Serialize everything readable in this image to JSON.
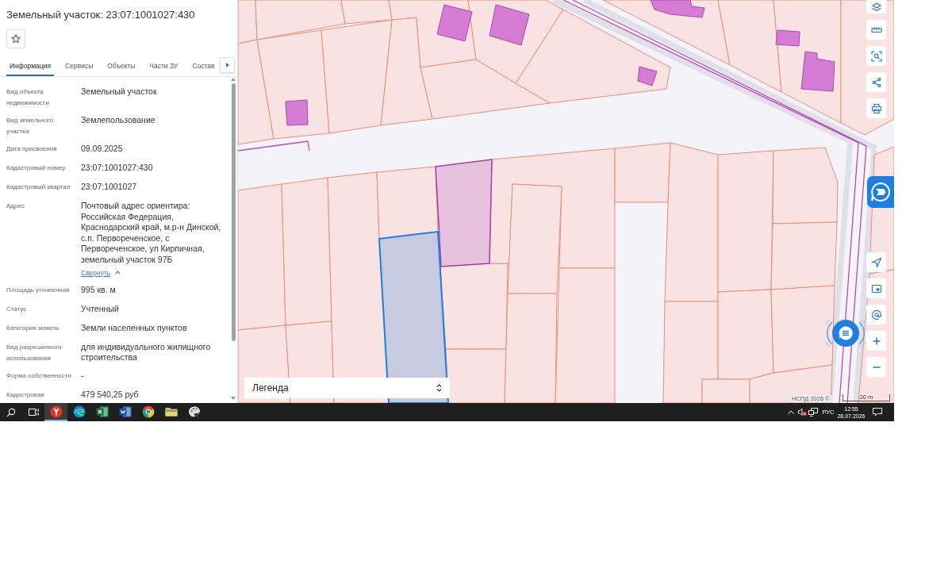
{
  "panel": {
    "title": "Земельный участок: 23:07:1001027:430",
    "tabs": [
      {
        "label": "Информация",
        "selected": true
      },
      {
        "label": "Сервисы",
        "selected": false
      },
      {
        "label": "Объекты",
        "selected": false
      },
      {
        "label": "Части ЗУ",
        "selected": false
      },
      {
        "label": "Состав",
        "selected": false
      }
    ],
    "fields": [
      {
        "label": "Вид объекта недвижимости",
        "value": "Земельный участок"
      },
      {
        "label": "Вид земельного участка",
        "value": "Землепользование"
      },
      {
        "label": "Дата присвоения",
        "value": "09.09.2025"
      },
      {
        "label": "Кадастровый номер",
        "value": "23:07:1001027:430"
      },
      {
        "label": "Кадастровый квартал",
        "value": "23:07:1001027"
      },
      {
        "label": "Адрес",
        "value": "Почтовый адрес ориентира: Российская Федерация, Краснодарский край, м.р-н Динской, с.п. Первореченское, с Первореченское, ул Кирпичная, земельный участок 97Б",
        "collapse_link": "Свернуть"
      },
      {
        "label": "Площадь уточненная",
        "value": "995 кв. м"
      },
      {
        "label": "Статус",
        "value": "Учтенный"
      },
      {
        "label": "Категория земель",
        "value": "Земли населенных пунктов"
      },
      {
        "label": "Вид разрешенного использования",
        "value": "для индивидуального жилищного строительства"
      },
      {
        "label": "Форма собственности",
        "value": "-"
      },
      {
        "label": "Кадастровая",
        "value": "479 540,25 руб"
      }
    ]
  },
  "map": {
    "legend": {
      "label": "Легенда"
    },
    "attribution": "НСПД 2026 ©",
    "scale": "20 m"
  },
  "taskbar": {
    "pinned_apps": [
      {
        "selected": true
      },
      {
        "selected": false
      },
      {
        "selected": false
      },
      {
        "selected": false
      },
      {
        "selected": false
      },
      {
        "selected": false
      },
      {
        "selected": false
      }
    ],
    "language": "РУС",
    "clock": {
      "time": "12:55",
      "date": "28.07.2026"
    }
  }
}
